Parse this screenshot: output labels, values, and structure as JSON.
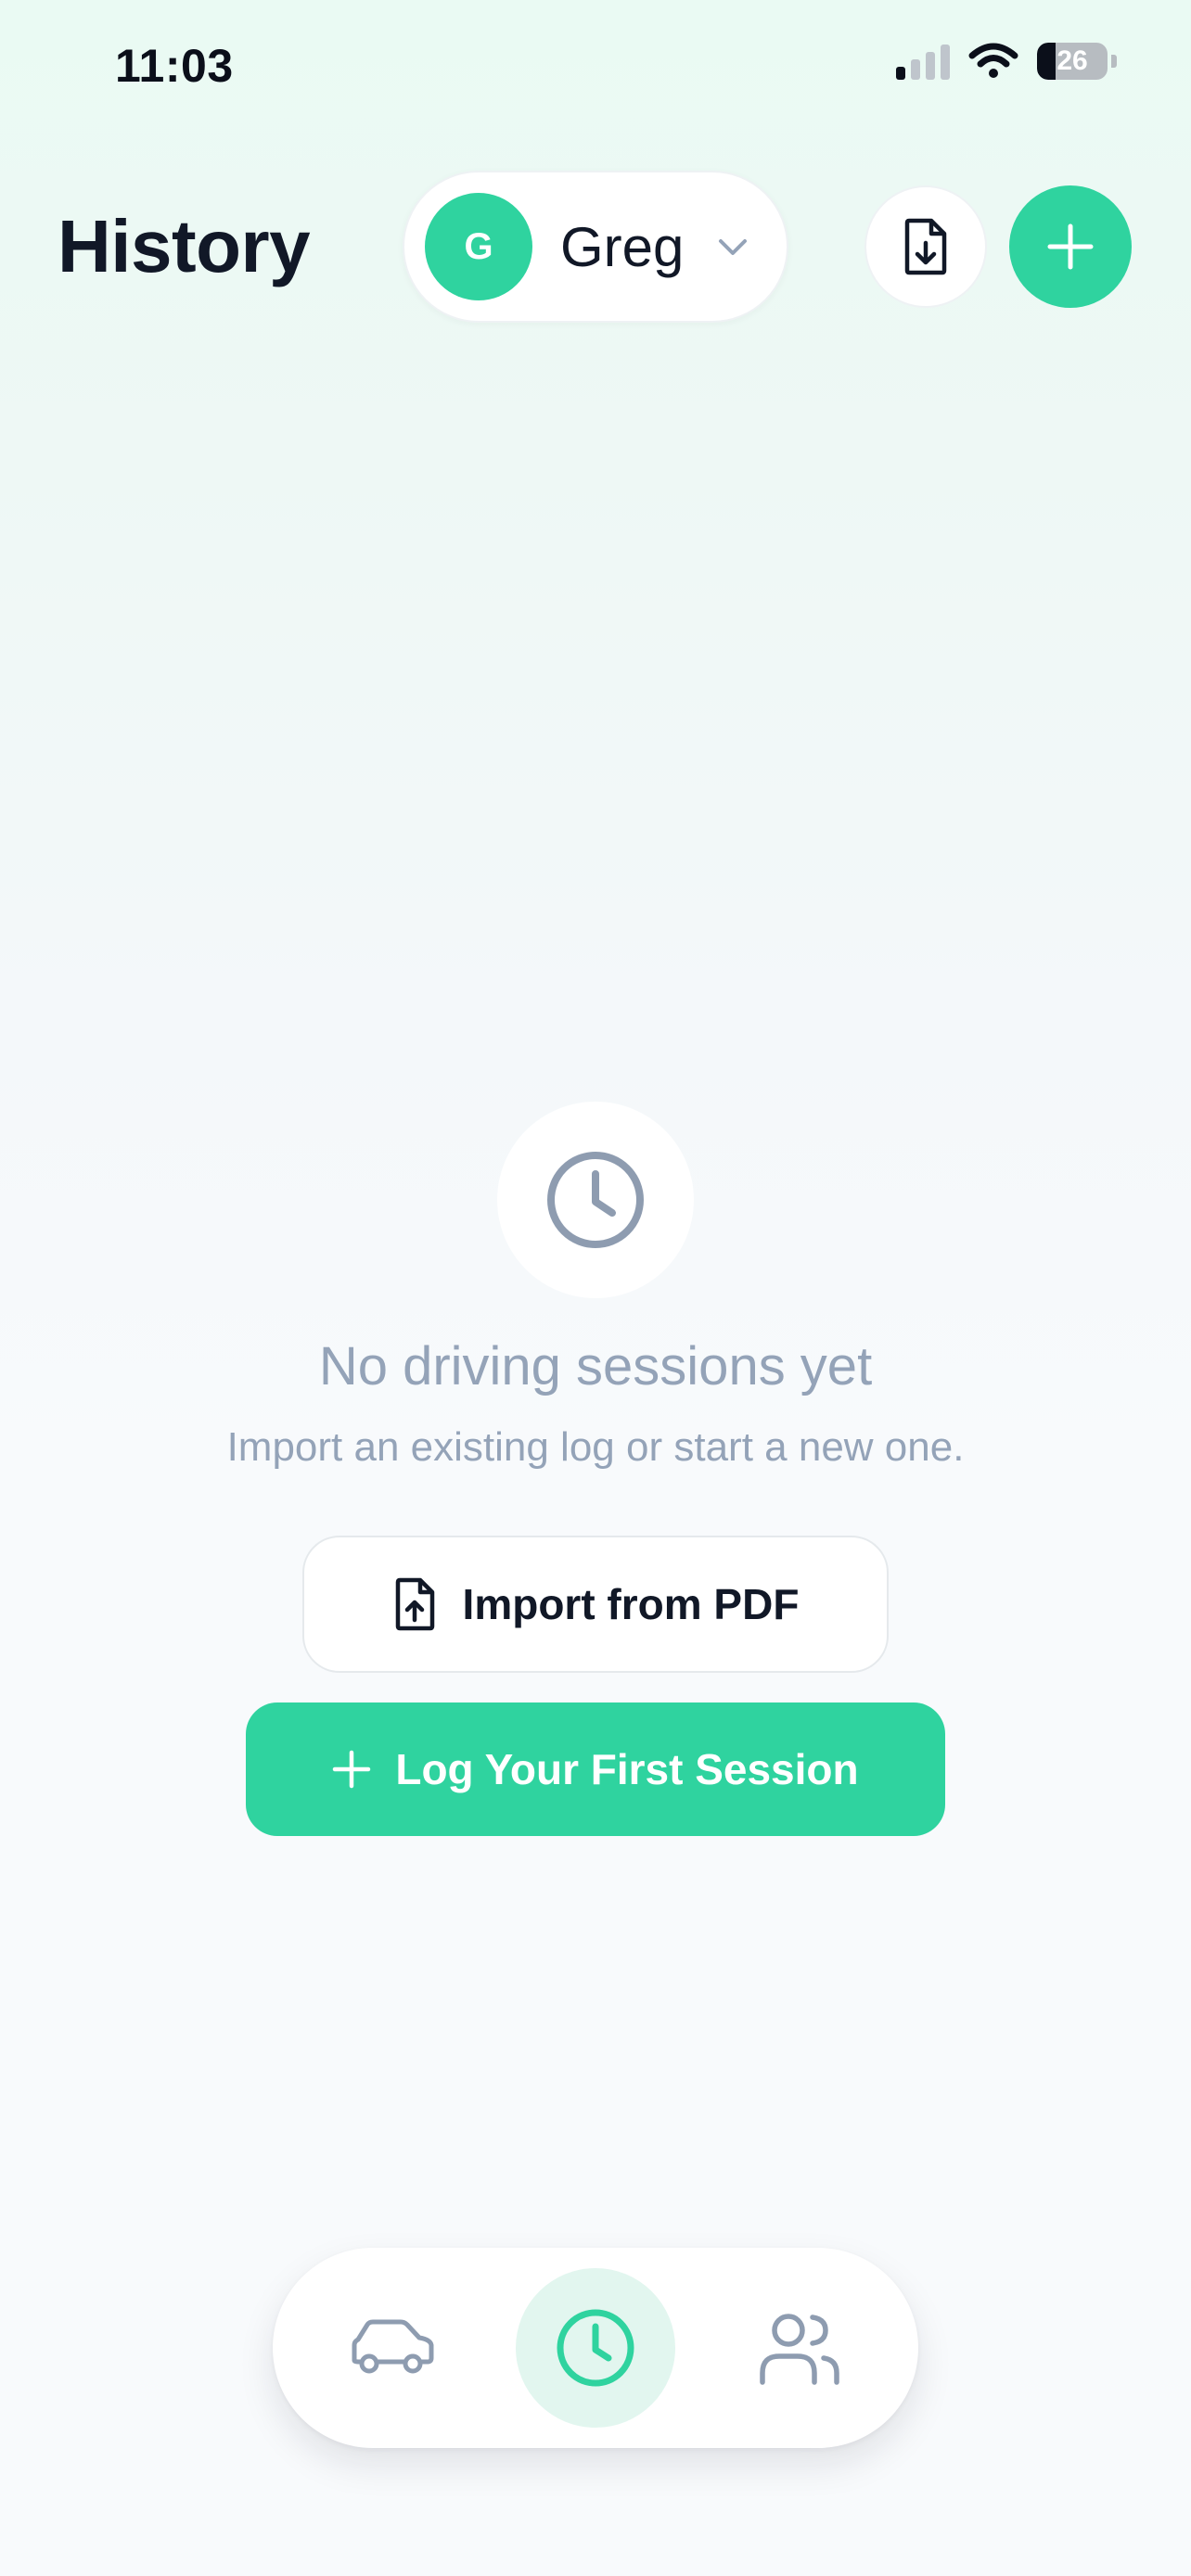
{
  "status_bar": {
    "time": "11:03",
    "battery": "26",
    "battery_level": 0.26
  },
  "header": {
    "title": "History",
    "profile": {
      "initial": "G",
      "name": "Greg"
    }
  },
  "empty_state": {
    "title": "No driving sessions yet",
    "subtitle": "Import an existing log or start a new one.",
    "import_label": "Import from PDF",
    "log_label": "Log Your First Session"
  },
  "nav": {
    "items": [
      {
        "icon": "car-icon",
        "active": false
      },
      {
        "icon": "clock-icon",
        "active": true
      },
      {
        "icon": "users-icon",
        "active": false
      }
    ]
  },
  "colors": {
    "accent": "#2fd39f",
    "text_primary": "#111827",
    "text_muted": "#94a3b8",
    "nav_active_bg": "#e2f6ef"
  }
}
